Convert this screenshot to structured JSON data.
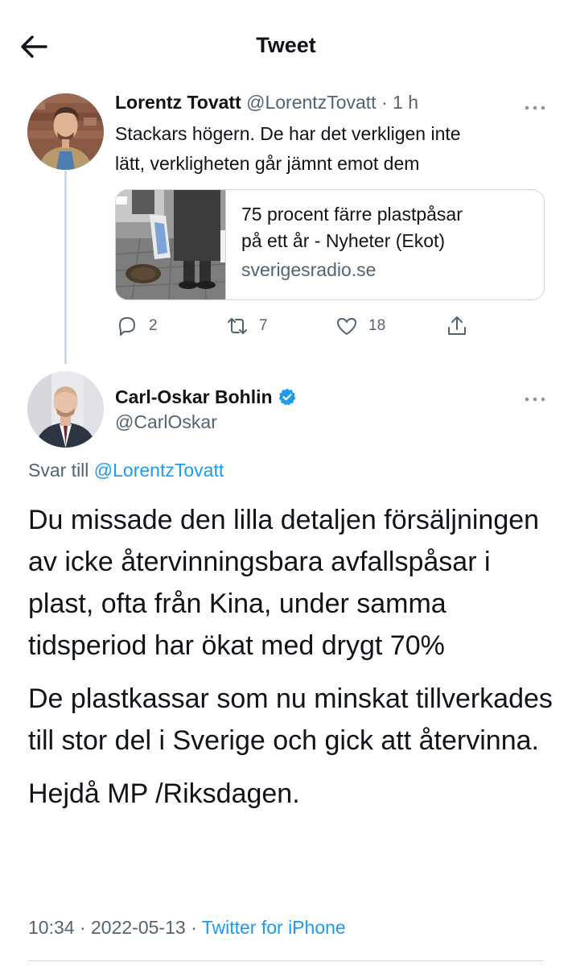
{
  "header": {
    "title": "Tweet",
    "back_icon": "arrow-left-icon"
  },
  "tweet1": {
    "name": "Lorentz Tovatt",
    "handle": "@LorentzTovatt",
    "separator": "·",
    "time": "1 h",
    "text_line1": "Stackars högern. De har det verkligen inte",
    "text_line2": "lätt, verkligheten går jämnt emot dem",
    "card": {
      "title_line1": "75 procent färre plastpåsar",
      "title_line2": "på ett år - Nyheter (Ekot)",
      "domain": "sverigesradio.se"
    },
    "actions": {
      "replies": "2",
      "retweets": "7",
      "likes": "18"
    }
  },
  "tweet2": {
    "name": "Carl-Oskar Bohlin",
    "handle": "@CarlOskar",
    "reply_prefix": "Svar till",
    "reply_handle": "@LorentzTovatt",
    "paragraphs": [
      "Du missade den lilla detaljen försäljningen av icke återvinningsbara avfallspåsar i plast, ofta från Kina, under samma tidsperiod har ökat med drygt 70%",
      "De plastkassar som nu minskat tillverkades till stor del i Sverige och gick att återvinna.",
      "Hejdå MP /Riksdagen."
    ],
    "time": "10:34",
    "separator": "·",
    "date": "2022-05-13",
    "source": "Twitter for iPhone"
  },
  "colors": {
    "accent": "#1d9bf0",
    "text": "#0f1419",
    "muted": "#536471",
    "border": "#cfd9de"
  }
}
